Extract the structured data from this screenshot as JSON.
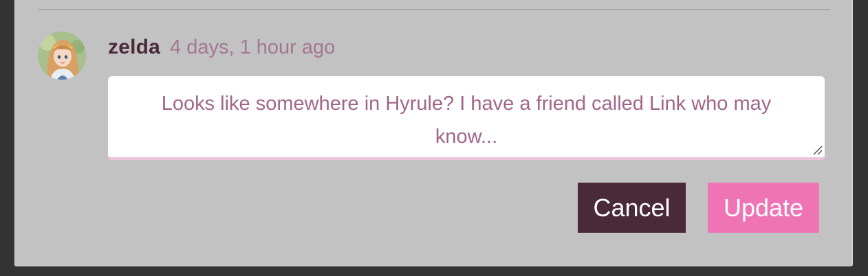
{
  "comment": {
    "username": "zelda",
    "timestamp": "4 days, 1 hour ago",
    "text": "Looks like somewhere in Hyrule? I have a friend called Link who may know..."
  },
  "actions": {
    "cancel_label": "Cancel",
    "update_label": "Update"
  },
  "colors": {
    "panel_background": "#c2c2c2",
    "page_background": "#333333",
    "username": "#4a2a36",
    "timestamp": "#a27890",
    "comment_text": "#a0668a",
    "cancel_button": "#4a2a38",
    "update_button": "#ee74b5",
    "textarea_underline": "#ecc6dc"
  },
  "icons": {
    "avatar": "user-avatar-image",
    "resize": "resize-grip-icon"
  }
}
